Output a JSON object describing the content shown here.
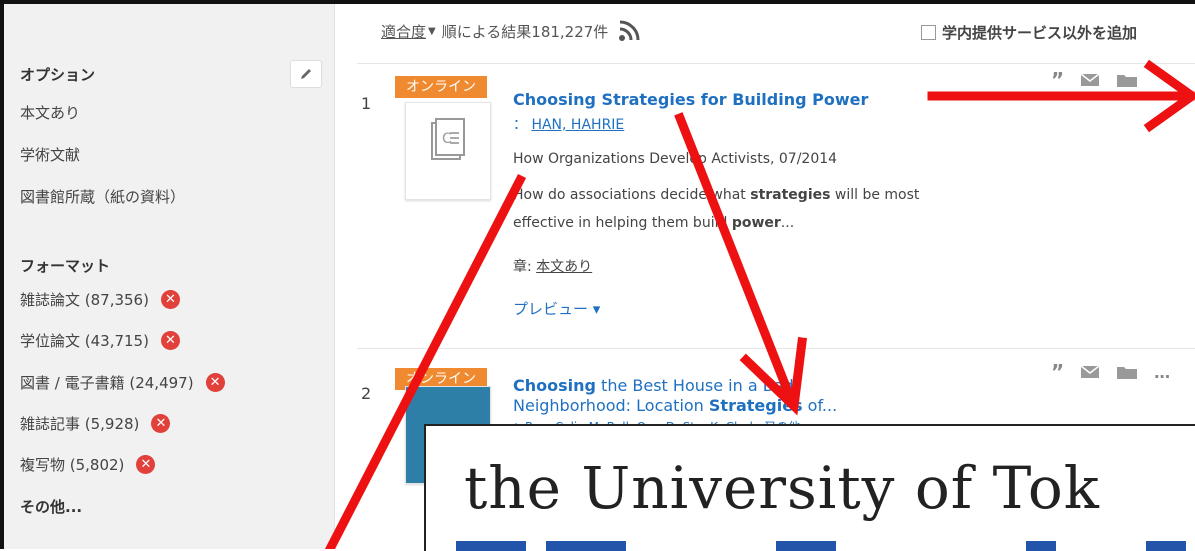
{
  "sidebar": {
    "options_heading": "オプション",
    "options": [
      "本文あり",
      "学術文献",
      "図書館所蔵（紙の資料）"
    ],
    "format_heading": "フォーマット",
    "formats": [
      {
        "label": "雑誌論文 (87,356)"
      },
      {
        "label": "学位論文 (43,715)"
      },
      {
        "label": "図書 / 電子書籍 (24,497)"
      },
      {
        "label": "雑誌記事 (5,928)"
      },
      {
        "label": "複写物 (5,802)"
      }
    ],
    "more": "その他..."
  },
  "toolbar": {
    "sort_link": "適合度",
    "results_text": "順による結果181,227件",
    "add_option": "学内提供サービス以外を追加"
  },
  "results": [
    {
      "number": "1",
      "badge": "オンライン",
      "title": "Choosing Strategies for Building Power",
      "author_prefix": "：",
      "author": "HAN, HAHRIE",
      "source": "How Organizations Develop Activists, 07/2014",
      "snippet_1": "How do associations decide what ",
      "snippet_bold1": "strategies",
      "snippet_2": " will be most",
      "snippet_3": "effective in helping them build ",
      "snippet_bold2": "power",
      "snippet_4": "...",
      "chapter_label": "章: ",
      "chapter_link": "本文あり",
      "preview": "プレビュー ▾"
    },
    {
      "number": "2",
      "badge": "オンライン",
      "title_bold": "Choosing",
      "title_rest": " the Best House in a Bad",
      "title_line2a": "Neighborhood: Location ",
      "title_line2b": "Strategies",
      "title_line2c": " of...",
      "author_partial": "：Roy, Colin M, Bell, Ore, D, Stu, K, Clark, 又の他"
    }
  ],
  "zoom_text": "the University of Tok",
  "colors": {
    "arrow": "#ee1111",
    "badge": "#f08a30",
    "link": "#1f70c1",
    "remove": "#e2403a"
  }
}
